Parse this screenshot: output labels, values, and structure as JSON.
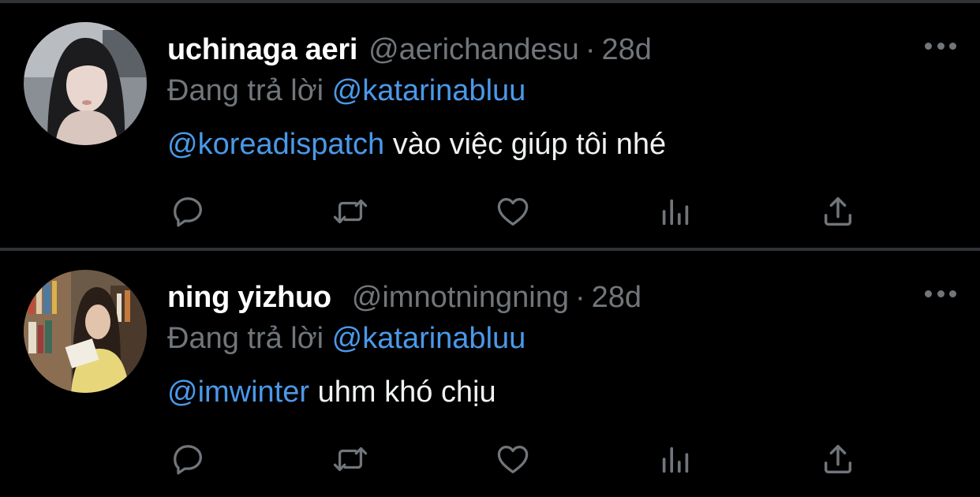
{
  "tweets": [
    {
      "name": "uchinaga aeri",
      "handle": "@aerichandesu",
      "separator": "·",
      "time": "28d",
      "reply_prefix": "Đang trả lời",
      "reply_to": "@katarinabluu",
      "mention": "@koreadispatch",
      "text": " vào việc giúp tôi nhé",
      "actions": [
        "reply-icon",
        "retweet-icon",
        "like-icon",
        "views-icon",
        "share-icon"
      ]
    },
    {
      "name": "ning yizhuo",
      "handle": "@imnotningning",
      "separator": "·",
      "time": "28d",
      "reply_prefix": "Đang trả lời",
      "reply_to": "@katarinabluu",
      "mention": "@imwinter",
      "text": " uhm khó chịu",
      "actions": [
        "reply-icon",
        "retweet-icon",
        "like-icon",
        "views-icon",
        "share-icon"
      ]
    }
  ],
  "colors": {
    "background": "#000000",
    "divider": "#2f3336",
    "muted": "#71767b",
    "link": "#4a99e9",
    "name": "#ffffff"
  }
}
